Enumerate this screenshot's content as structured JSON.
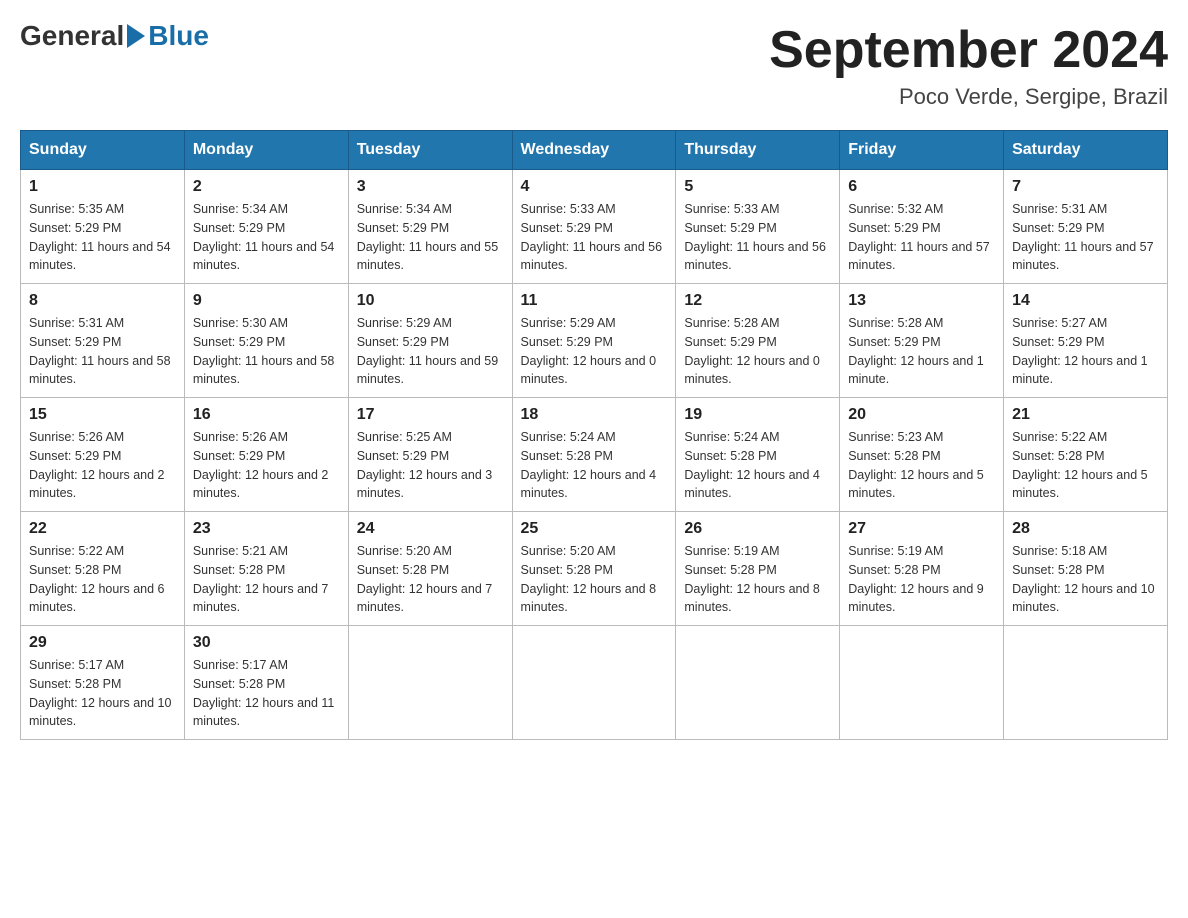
{
  "logo": {
    "general": "General",
    "blue": "Blue"
  },
  "title": "September 2024",
  "location": "Poco Verde, Sergipe, Brazil",
  "weekdays": [
    "Sunday",
    "Monday",
    "Tuesday",
    "Wednesday",
    "Thursday",
    "Friday",
    "Saturday"
  ],
  "weeks": [
    [
      {
        "day": "1",
        "sunrise": "5:35 AM",
        "sunset": "5:29 PM",
        "daylight": "11 hours and 54 minutes."
      },
      {
        "day": "2",
        "sunrise": "5:34 AM",
        "sunset": "5:29 PM",
        "daylight": "11 hours and 54 minutes."
      },
      {
        "day": "3",
        "sunrise": "5:34 AM",
        "sunset": "5:29 PM",
        "daylight": "11 hours and 55 minutes."
      },
      {
        "day": "4",
        "sunrise": "5:33 AM",
        "sunset": "5:29 PM",
        "daylight": "11 hours and 56 minutes."
      },
      {
        "day": "5",
        "sunrise": "5:33 AM",
        "sunset": "5:29 PM",
        "daylight": "11 hours and 56 minutes."
      },
      {
        "day": "6",
        "sunrise": "5:32 AM",
        "sunset": "5:29 PM",
        "daylight": "11 hours and 57 minutes."
      },
      {
        "day": "7",
        "sunrise": "5:31 AM",
        "sunset": "5:29 PM",
        "daylight": "11 hours and 57 minutes."
      }
    ],
    [
      {
        "day": "8",
        "sunrise": "5:31 AM",
        "sunset": "5:29 PM",
        "daylight": "11 hours and 58 minutes."
      },
      {
        "day": "9",
        "sunrise": "5:30 AM",
        "sunset": "5:29 PM",
        "daylight": "11 hours and 58 minutes."
      },
      {
        "day": "10",
        "sunrise": "5:29 AM",
        "sunset": "5:29 PM",
        "daylight": "11 hours and 59 minutes."
      },
      {
        "day": "11",
        "sunrise": "5:29 AM",
        "sunset": "5:29 PM",
        "daylight": "12 hours and 0 minutes."
      },
      {
        "day": "12",
        "sunrise": "5:28 AM",
        "sunset": "5:29 PM",
        "daylight": "12 hours and 0 minutes."
      },
      {
        "day": "13",
        "sunrise": "5:28 AM",
        "sunset": "5:29 PM",
        "daylight": "12 hours and 1 minute."
      },
      {
        "day": "14",
        "sunrise": "5:27 AM",
        "sunset": "5:29 PM",
        "daylight": "12 hours and 1 minute."
      }
    ],
    [
      {
        "day": "15",
        "sunrise": "5:26 AM",
        "sunset": "5:29 PM",
        "daylight": "12 hours and 2 minutes."
      },
      {
        "day": "16",
        "sunrise": "5:26 AM",
        "sunset": "5:29 PM",
        "daylight": "12 hours and 2 minutes."
      },
      {
        "day": "17",
        "sunrise": "5:25 AM",
        "sunset": "5:29 PM",
        "daylight": "12 hours and 3 minutes."
      },
      {
        "day": "18",
        "sunrise": "5:24 AM",
        "sunset": "5:28 PM",
        "daylight": "12 hours and 4 minutes."
      },
      {
        "day": "19",
        "sunrise": "5:24 AM",
        "sunset": "5:28 PM",
        "daylight": "12 hours and 4 minutes."
      },
      {
        "day": "20",
        "sunrise": "5:23 AM",
        "sunset": "5:28 PM",
        "daylight": "12 hours and 5 minutes."
      },
      {
        "day": "21",
        "sunrise": "5:22 AM",
        "sunset": "5:28 PM",
        "daylight": "12 hours and 5 minutes."
      }
    ],
    [
      {
        "day": "22",
        "sunrise": "5:22 AM",
        "sunset": "5:28 PM",
        "daylight": "12 hours and 6 minutes."
      },
      {
        "day": "23",
        "sunrise": "5:21 AM",
        "sunset": "5:28 PM",
        "daylight": "12 hours and 7 minutes."
      },
      {
        "day": "24",
        "sunrise": "5:20 AM",
        "sunset": "5:28 PM",
        "daylight": "12 hours and 7 minutes."
      },
      {
        "day": "25",
        "sunrise": "5:20 AM",
        "sunset": "5:28 PM",
        "daylight": "12 hours and 8 minutes."
      },
      {
        "day": "26",
        "sunrise": "5:19 AM",
        "sunset": "5:28 PM",
        "daylight": "12 hours and 8 minutes."
      },
      {
        "day": "27",
        "sunrise": "5:19 AM",
        "sunset": "5:28 PM",
        "daylight": "12 hours and 9 minutes."
      },
      {
        "day": "28",
        "sunrise": "5:18 AM",
        "sunset": "5:28 PM",
        "daylight": "12 hours and 10 minutes."
      }
    ],
    [
      {
        "day": "29",
        "sunrise": "5:17 AM",
        "sunset": "5:28 PM",
        "daylight": "12 hours and 10 minutes."
      },
      {
        "day": "30",
        "sunrise": "5:17 AM",
        "sunset": "5:28 PM",
        "daylight": "12 hours and 11 minutes."
      },
      null,
      null,
      null,
      null,
      null
    ]
  ]
}
